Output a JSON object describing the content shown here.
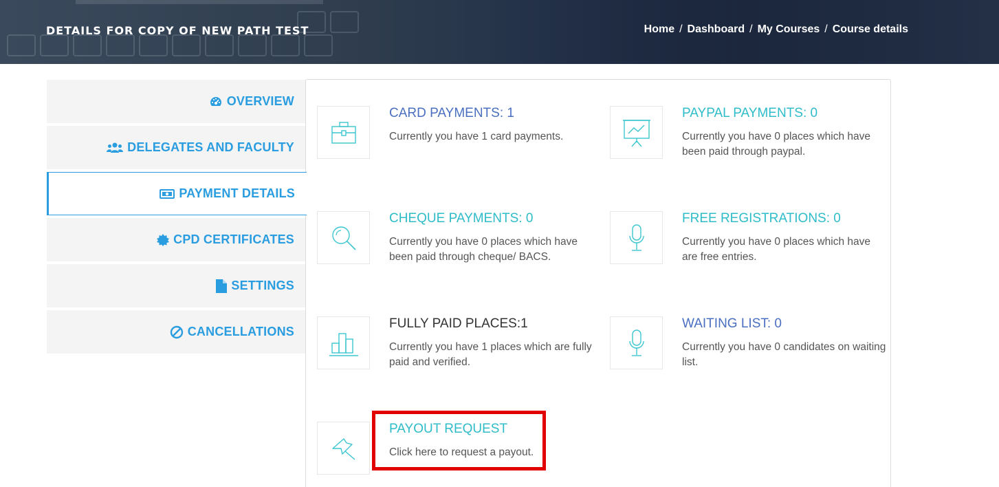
{
  "header": {
    "title": "DETAILS FOR COPY OF NEW PATH TEST",
    "breadcrumb": [
      "Home",
      "Dashboard",
      "My Courses",
      "Course details"
    ],
    "separator": "/"
  },
  "sidebar": {
    "items": [
      {
        "label": "OVERVIEW",
        "icon": "dashboard-icon",
        "active": false
      },
      {
        "label": "DELEGATES AND FACULTY",
        "icon": "users-icon",
        "active": false
      },
      {
        "label": "PAYMENT DETAILS",
        "icon": "money-icon",
        "active": true
      },
      {
        "label": "CPD CERTIFICATES",
        "icon": "certificate-icon",
        "active": false
      },
      {
        "label": "SETTINGS",
        "icon": "file-icon",
        "active": false
      },
      {
        "label": "CANCELLATIONS",
        "icon": "ban-icon",
        "active": false
      }
    ]
  },
  "cards": {
    "card_payments": {
      "title": "CARD PAYMENTS: 1",
      "desc": "Currently you have 1 card payments.",
      "icon": "briefcase-icon"
    },
    "paypal_payments": {
      "title": "PAYPAL PAYMENTS: 0",
      "desc": "Currently you have 0 places which have been paid through paypal.",
      "icon": "presentation-icon"
    },
    "cheque_payments": {
      "title": "CHEQUE PAYMENTS: 0",
      "desc": "Currently you have 0 places which have been paid through cheque/ BACS.",
      "icon": "magnifier-icon"
    },
    "free_registrations": {
      "title": "FREE REGISTRATIONS: 0",
      "desc": "Currently you have 0 places which have are free entries.",
      "icon": "microphone-icon"
    },
    "fully_paid": {
      "title": "FULLY PAID PLACES:1",
      "desc": "Currently you have 1 places which are fully paid and verified.",
      "icon": "bar-chart-icon"
    },
    "waiting_list": {
      "title": "WAITING LIST: 0",
      "desc": "Currently you have 0 candidates on waiting list.",
      "icon": "microphone-icon"
    },
    "payout_request": {
      "title": "PAYOUT REQUEST",
      "desc": "Click here to request a payout.",
      "icon": "pin-icon"
    }
  },
  "colors": {
    "accent_blue": "#2a9de0",
    "title_indigo": "#4a6fc0",
    "title_teal": "#2fbcc9",
    "title_dark": "#333333",
    "icon_teal": "#3cc6cf",
    "highlight_red": "#e00000"
  }
}
